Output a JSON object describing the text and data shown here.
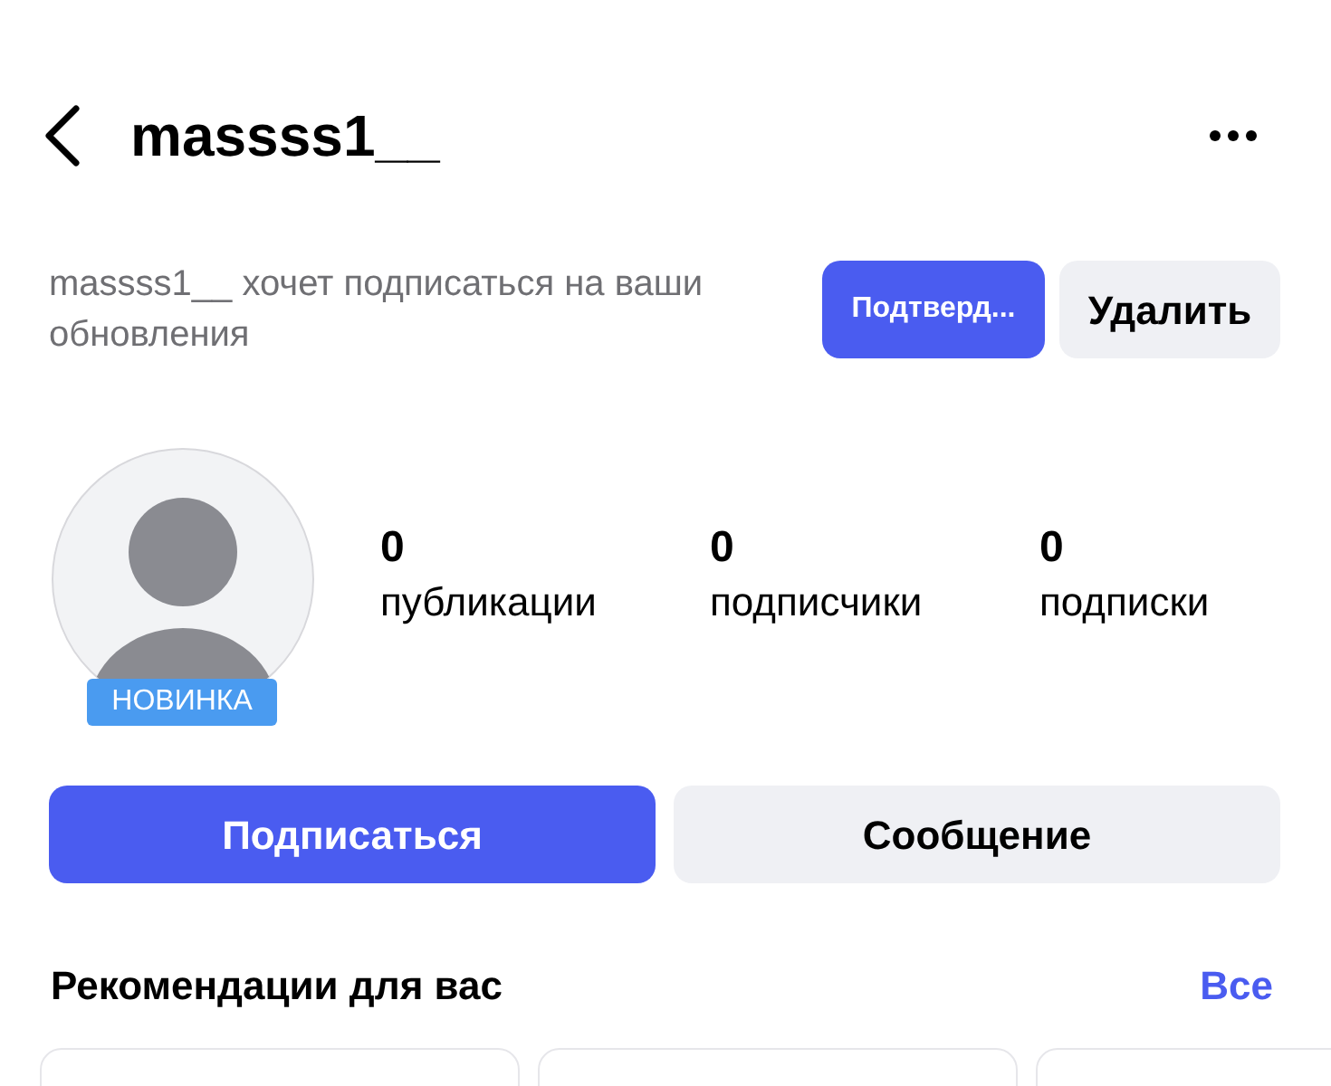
{
  "header": {
    "title": "massss1__"
  },
  "request": {
    "text": "massss1__ хочет подписаться на ваши обновления",
    "buttons": [
      {
        "label": "Подтверд...",
        "kind": "primary"
      },
      {
        "label": "Удалить",
        "kind": "secondary"
      }
    ]
  },
  "profile": {
    "badge": "НОВИНКА",
    "stats": [
      {
        "value": "0",
        "label": "публикации"
      },
      {
        "value": "0",
        "label": "подписчики"
      },
      {
        "value": "0",
        "label": "подписки"
      }
    ]
  },
  "actions": [
    {
      "label": "Подписаться",
      "kind": "primary"
    },
    {
      "label": "Сообщение",
      "kind": "secondary"
    }
  ],
  "recommendations": {
    "title": "Рекомендации для вас",
    "link": "Все"
  }
}
